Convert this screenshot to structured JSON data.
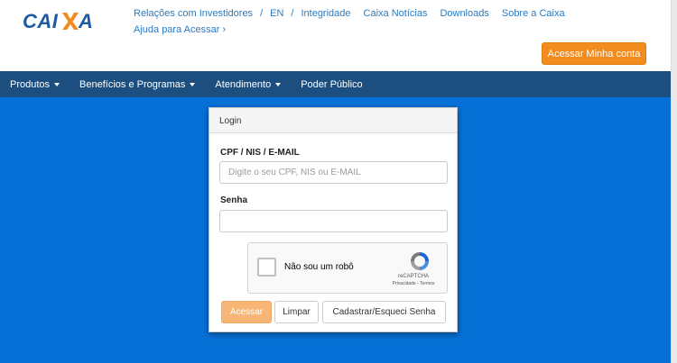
{
  "header": {
    "logo_text": "CAIXA",
    "links_row1": [
      "Relações com Investidores",
      "EN",
      "Integridade",
      "Caixa Notícias",
      "Downloads",
      "Sobre a Caixa"
    ],
    "link_sep": "/",
    "links_row2": "Ajuda para Acessar ›",
    "account_button": "Acessar Minha conta"
  },
  "nav": {
    "items": [
      "Produtos",
      "Benefícios e Programas",
      "Atendimento",
      "Poder Público"
    ]
  },
  "login": {
    "title": "Login",
    "user_label": "CPF / NIS / E-MAIL",
    "user_value": "",
    "user_placeholder": "Digite o seu CPF, NIS ou E-MAIL",
    "password_label": "Senha",
    "password_value": "",
    "captcha_label": "Não sou um robô",
    "captcha_brand": "reCAPTCHA",
    "captcha_links": "Privacidade - Termos",
    "buttons": {
      "submit": "Acessar",
      "clear": "Limpar",
      "register": "Cadastrar/Esqueci Senha"
    }
  },
  "colors": {
    "brand_blue": "#1c4f80",
    "background_blue": "#0670d6",
    "accent_orange": "#f28c1e",
    "link_blue": "#2b7bc1"
  }
}
